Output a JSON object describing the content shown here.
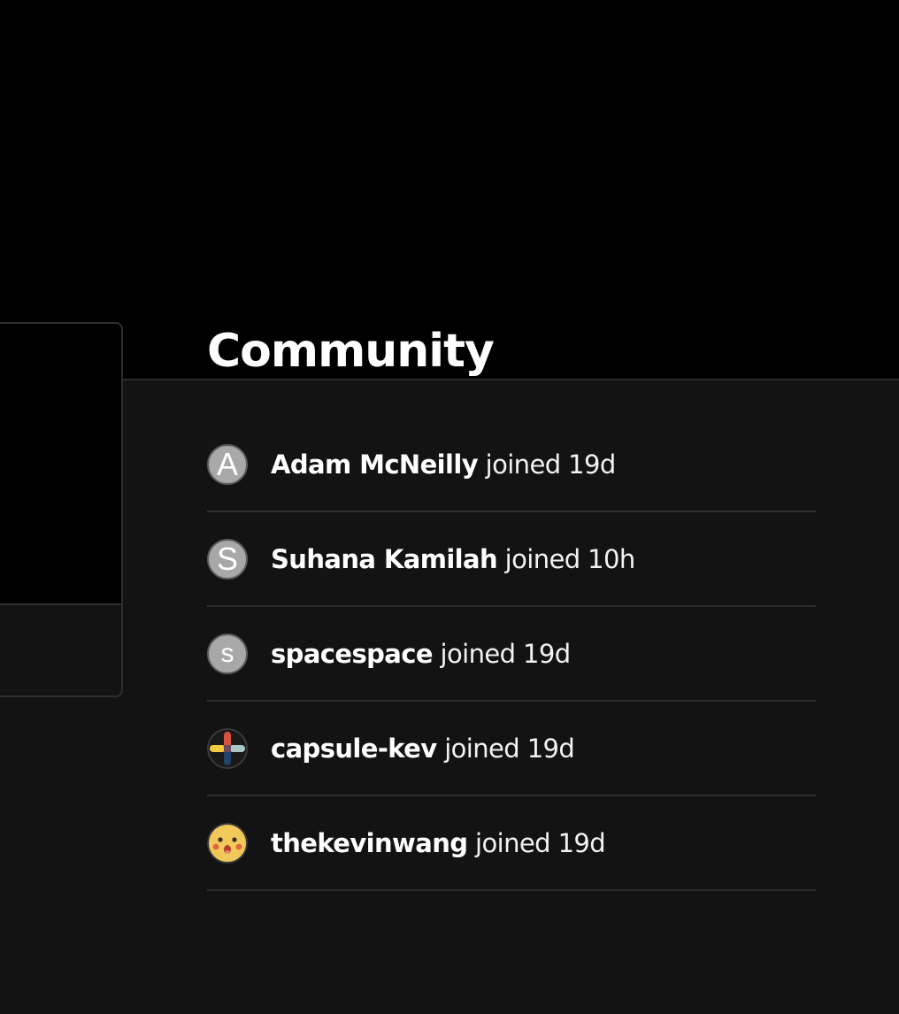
{
  "section": {
    "title": "Community"
  },
  "members": [
    {
      "name": "Adam McNeilly",
      "action": "joined",
      "time": "19d",
      "avatar_letter": "A"
    },
    {
      "name": "Suhana Kamilah",
      "action": "joined",
      "time": "10h",
      "avatar_letter": "S"
    },
    {
      "name": "spacespace",
      "action": "joined",
      "time": "19d",
      "avatar_letter": "s"
    },
    {
      "name": "capsule-kev",
      "action": "joined",
      "time": "19d",
      "avatar_icon": "capsule-cross-avatar-icon"
    },
    {
      "name": "thekevinwang",
      "action": "joined",
      "time": "19d",
      "avatar_icon": "pikachu-face-avatar-icon"
    }
  ],
  "colors": {
    "background_top": "#000000",
    "background_lower": "#131313",
    "divider": "#2e2e2e",
    "text": "#ffffff",
    "avatar_letter_bg": "#a8a8a8"
  }
}
